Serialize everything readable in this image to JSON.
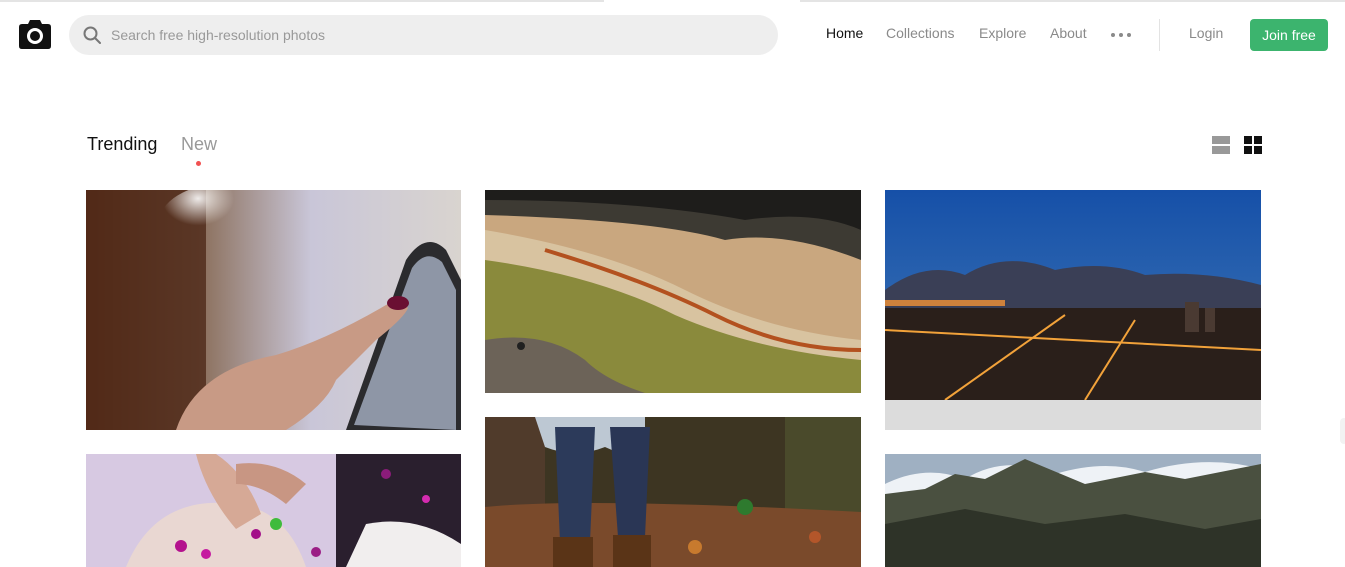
{
  "header": {
    "logo_icon": "camera-icon",
    "search": {
      "placeholder": "Search free high-resolution photos",
      "value": "",
      "icon": "search-icon"
    },
    "nav": [
      {
        "label": "Home",
        "active": true
      },
      {
        "label": "Collections",
        "active": false
      },
      {
        "label": "Explore",
        "active": false
      },
      {
        "label": "About",
        "active": false
      }
    ],
    "more_icon": "more-dots-icon",
    "login_label": "Login",
    "join_label": "Join free",
    "accent_color": "#3cb46e"
  },
  "feed": {
    "tabs": [
      {
        "label": "Trending",
        "active": false
      },
      {
        "label": "New",
        "active": true
      }
    ],
    "active_indicator_color": "#f15151",
    "view_toggles": [
      {
        "icon": "list-view-icon",
        "active": false
      },
      {
        "icon": "grid-view-icon",
        "active": true
      }
    ]
  }
}
